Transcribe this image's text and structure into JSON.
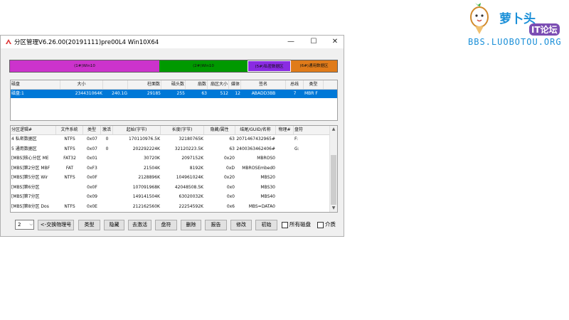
{
  "logo": {
    "brand": "萝卜头",
    "tag": "IT论坛",
    "site": "BBS.LUOBOTOU.ORG"
  },
  "window": {
    "title": "分区管理V6.26.00(20191111)pre00L4 Win10X64",
    "controls": {
      "minimize": "—",
      "maximize": "☐",
      "close": "✕"
    }
  },
  "diskbar": {
    "segments": [
      {
        "label": "(1#)Win10",
        "color": "#cc33cc"
      },
      {
        "label": "(2#)Win10",
        "color": "#009900"
      },
      {
        "label": "(5#)私密数据区",
        "color": "#8a2be2"
      },
      {
        "label": "(6#)通用数据区",
        "color": "#e07b1a"
      }
    ]
  },
  "disk_table": {
    "headers": [
      "磁盘",
      "大小",
      "",
      "柱面数",
      "磁头数",
      "扇数",
      "扇区大小",
      "媒体",
      "签名",
      "总线",
      "类型"
    ],
    "rows": [
      [
        "磁盘:1",
        "234431064K",
        "240.1G",
        "29185",
        "255",
        "63",
        "512",
        "12",
        "ABADD3BB",
        "7",
        "MBR F"
      ]
    ]
  },
  "partition_table": {
    "headers": [
      "分区逻辑#",
      "文件系统",
      "类型",
      "激活",
      "起始(字节)",
      "长度(字节)",
      "隐藏/属性",
      "结尾/GUID/名称",
      "物理#",
      "盘符"
    ],
    "rows": [
      [
        "4 私密数据区",
        "NTFS",
        "0x07",
        "0",
        "170110976.5K",
        "32180765K",
        "63",
        "2071467432965#",
        "",
        "F:"
      ],
      [
        "5 通用数据区",
        "NTFS",
        "0x07",
        "0",
        "202292224K",
        "32120223.5K",
        "63",
        "2400363462406#",
        "",
        "G:"
      ],
      [
        "[MBS]核心分区 ME",
        "FAT32",
        "0x01",
        "",
        "30720K",
        "2097152K",
        "0x20",
        "MBROS0",
        "",
        ""
      ],
      [
        "[MBS]第2分区 MBF",
        "FAT",
        "0xF3",
        "",
        "21504K",
        "8192K",
        "0xD",
        "MBROSEmbed0",
        "",
        ""
      ],
      [
        "[MBS]第5分区 Wir",
        "NTFS",
        "0x0F",
        "",
        "2128896K",
        "104961024K",
        "0x20",
        "MBS20",
        "",
        ""
      ],
      [
        "[MBS]第6分区",
        "",
        "0x0F",
        "",
        "107091968K",
        "42048508.5K",
        "0x0",
        "MBS30",
        "",
        ""
      ],
      [
        "[MBS]第7分区",
        "",
        "0x09",
        "",
        "149141504K",
        "63020032K",
        "0x0",
        "MBS40",
        "",
        ""
      ],
      [
        "[MBS]第8分区 Dos",
        "NTFS",
        "0x0E",
        "",
        "212162560K",
        "22254592K",
        "0x6",
        "MBS=DATA0",
        "",
        ""
      ]
    ]
  },
  "toolbar": {
    "disk_select": "2",
    "buttons": [
      "<-交换物理号",
      "类型",
      "隐藏",
      "去激活",
      "盘符",
      "删除",
      "报告",
      "修改",
      "初始"
    ],
    "checkboxes": [
      {
        "label": "所有磁盘",
        "checked": false
      },
      {
        "label": "介质",
        "checked": false
      }
    ]
  }
}
